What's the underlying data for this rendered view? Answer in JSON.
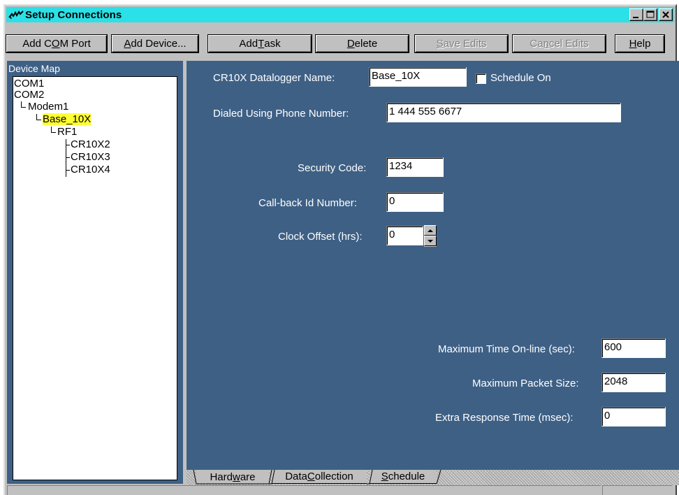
{
  "window": {
    "title": "Setup Connections"
  },
  "toolbar": {
    "add_com_port": {
      "pre": "Add C",
      "u": "O",
      "post": "M Port"
    },
    "add_device": {
      "pre": "",
      "u": "A",
      "post": "dd Device..."
    },
    "add_task": {
      "pre": "Add ",
      "u": "T",
      "post": "ask"
    },
    "delete": {
      "pre": "",
      "u": "D",
      "post": "elete"
    },
    "save_edits": {
      "pre": "",
      "u": "S",
      "post": "ave Edits"
    },
    "cancel_edits": {
      "pre": "Ca",
      "u": "n",
      "post": "cel Edits"
    },
    "help": {
      "pre": "",
      "u": "H",
      "post": "elp"
    }
  },
  "device_map": {
    "title": "Device Map",
    "items": [
      "COM1",
      "COM2",
      "Modem1",
      "Base_10X",
      "RF1",
      "CR10X2",
      "CR10X3",
      "CR10X4"
    ]
  },
  "form": {
    "name_label": "CR10X Datalogger Name:",
    "name_value": "Base_10X",
    "schedule_label": "Schedule On",
    "schedule_checked": false,
    "phone_label": "Dialed Using Phone Number:",
    "phone_value": "1 444 555 6677",
    "security_label": "Security Code:",
    "security_value": "1234",
    "callback_label": "Call-back Id Number:",
    "callback_value": "0",
    "clock_label": "Clock Offset (hrs):",
    "clock_value": "0",
    "max_time_label": "Maximum Time On-line (sec):",
    "max_time_value": "600",
    "max_packet_label": "Maximum Packet Size:",
    "max_packet_value": "2048",
    "extra_response_label": "Extra Response Time (msec):",
    "extra_response_value": "0"
  },
  "tabs": {
    "hardware": {
      "pre": "Hard",
      "u": "w",
      "post": "are"
    },
    "data_collection": {
      "pre": "Data ",
      "u": "C",
      "post": "ollection"
    },
    "schedule": {
      "pre": "",
      "u": "S",
      "post": "chedule"
    }
  },
  "colors": {
    "titlebar": "#2be0e6",
    "panel": "#3e6085",
    "selection": "#ffff33"
  },
  "icons": {
    "app": "antenna-icon",
    "minimize": "minimize-icon",
    "maximize": "maximize-icon",
    "close": "close-icon",
    "spin_up": "up-arrow-icon",
    "spin_down": "down-arrow-icon"
  }
}
